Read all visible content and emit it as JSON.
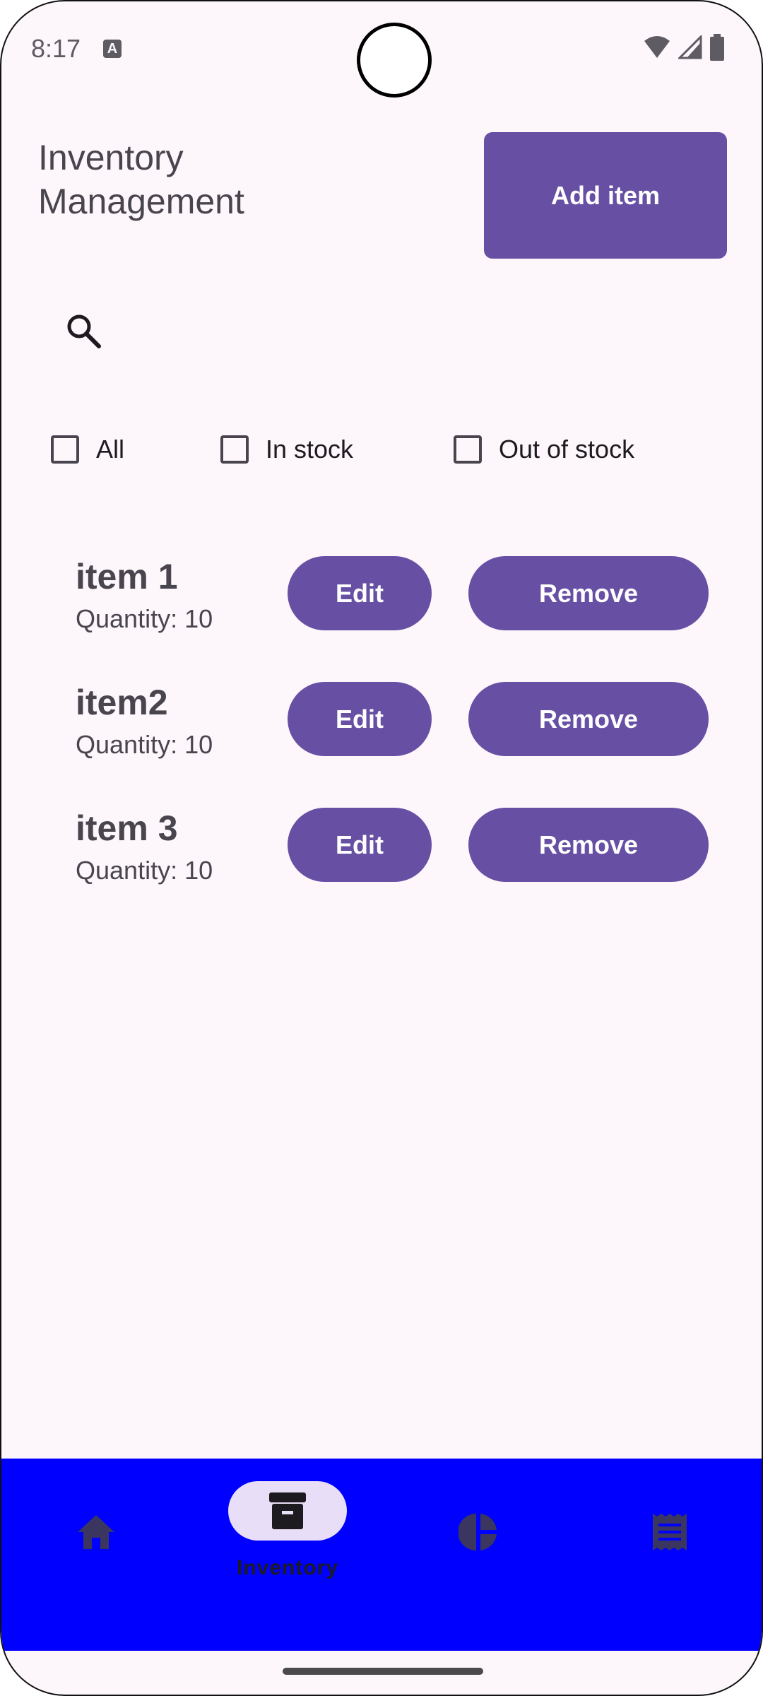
{
  "status_bar": {
    "time": "8:17",
    "notification_icon": "a-icon",
    "icons": [
      "wifi-icon",
      "signal-icon",
      "battery-icon"
    ]
  },
  "header": {
    "title": "Inventory Management",
    "add_button_label": "Add item"
  },
  "search": {
    "icon": "search-icon",
    "value": "",
    "placeholder": ""
  },
  "filters": [
    {
      "label": "All",
      "checked": false
    },
    {
      "label": "In stock",
      "checked": false
    },
    {
      "label": "Out of stock",
      "checked": false
    }
  ],
  "items": [
    {
      "name": "item 1",
      "quantity": "Quantity: 10",
      "edit_label": "Edit",
      "remove_label": "Remove"
    },
    {
      "name": "item2",
      "quantity": "Quantity: 10",
      "edit_label": "Edit",
      "remove_label": "Remove"
    },
    {
      "name": "item 3",
      "quantity": "Quantity: 10",
      "edit_label": "Edit",
      "remove_label": "Remove"
    }
  ],
  "bottom_nav": {
    "items": [
      {
        "icon": "home-icon",
        "label": ""
      },
      {
        "icon": "archive-box-icon",
        "label": "Inventory",
        "selected": true
      },
      {
        "icon": "pie-chart-icon",
        "label": ""
      },
      {
        "icon": "receipt-icon",
        "label": ""
      }
    ]
  },
  "colors": {
    "background": "#fdf7fb",
    "primary": "#6750a4",
    "nav_background": "#0000ff",
    "nav_indicator": "#e8def8",
    "text": "#49454f"
  }
}
